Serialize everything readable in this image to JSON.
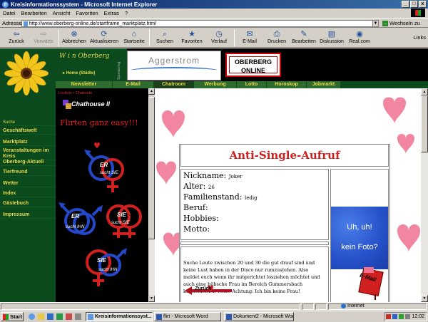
{
  "window": {
    "title": "Kreisinformationssystem - Microsoft Internet Explorer",
    "controls": [
      "_",
      "□",
      "x"
    ]
  },
  "menu": [
    "Datei",
    "Bearbeiten",
    "Ansicht",
    "Favoriten",
    "Extras",
    "?"
  ],
  "address": {
    "label": "Adresse",
    "url": "http://www.oberberg-online.de/startframe_marktplatz.html",
    "go_label": "Wechseln zu"
  },
  "toolbar": {
    "buttons": [
      {
        "label": "Zurück",
        "icon": "back-arrow-icon",
        "glyph": "⇦",
        "disabled": false
      },
      {
        "label": "Vorwärts",
        "icon": "forward-arrow-icon",
        "glyph": "⇨",
        "disabled": true
      },
      {
        "label": "Abbrechen",
        "icon": "stop-icon",
        "glyph": "⊗",
        "disabled": false
      },
      {
        "label": "Aktualisieren",
        "icon": "refresh-icon",
        "glyph": "⟳",
        "disabled": false
      },
      {
        "label": "Startseite",
        "icon": "home-icon",
        "glyph": "⌂",
        "disabled": false
      },
      {
        "label": "Suchen",
        "icon": "search-icon",
        "glyph": "⌕",
        "disabled": false
      },
      {
        "label": "Favoriten",
        "icon": "favorites-icon",
        "glyph": "★",
        "disabled": false
      },
      {
        "label": "Verlauf",
        "icon": "history-icon",
        "glyph": "◷",
        "disabled": false
      },
      {
        "label": "E-Mail",
        "icon": "mail-icon",
        "glyph": "✉",
        "disabled": false
      },
      {
        "label": "Drucken",
        "icon": "print-icon",
        "glyph": "⎙",
        "disabled": false
      },
      {
        "label": "Bearbeiten",
        "icon": "edit-icon",
        "glyph": "✎",
        "disabled": false
      },
      {
        "label": "Diskussion",
        "icon": "discussion-icon",
        "glyph": "▤",
        "disabled": false
      },
      {
        "label": "Real.com",
        "icon": "realcom-icon",
        "glyph": "◉",
        "disabled": false
      }
    ],
    "links_label": "Links"
  },
  "site": {
    "script_title": "W i n Oberberg",
    "home_link": "Home (Städte)",
    "sponsor_label": "Sponsoring",
    "banner1": "Aggerstrom",
    "banner2_line1": "OBERBERG",
    "banner2_line2": "ONLINE",
    "nav_tabs": [
      "Newsletter",
      "E-Mail",
      "Chatroom",
      "Werbung",
      "Lotto",
      "Horoskop",
      "Jobmarkt"
    ],
    "active_tab": "Chatroom",
    "sidebar": [
      {
        "label": "Suche",
        "small": true
      },
      {
        "label": "Geschäftswelt",
        "small": false
      },
      {
        "label": "Marktplatz",
        "small": false
      },
      {
        "label": "Veranstaltungen im Kreis",
        "small": false
      },
      {
        "label": "Oberberg-Aktuell",
        "small": false
      },
      {
        "label": "Tierfreund",
        "small": false
      },
      {
        "label": "Wetter",
        "small": false
      },
      {
        "label": "Index",
        "small": false
      },
      {
        "label": "Gästebuch",
        "small": false
      },
      {
        "label": "Impressum",
        "small": false
      }
    ]
  },
  "chat": {
    "links": "Lexikon • Chatcode",
    "logo": "Chathouse II",
    "tagline": "Flirten ganz easy!!!",
    "symbols": [
      {
        "top": "ER",
        "bottom": "sucht SIE"
      },
      {
        "top": "ER",
        "bottom": "sucht IHN"
      },
      {
        "top": "SIE",
        "bottom": "sucht SIE"
      },
      {
        "top": "SIE",
        "bottom": "sucht IHN"
      }
    ]
  },
  "aufruf": {
    "title": "Anti-Single-Aufruf",
    "fields": [
      {
        "label": "Nickname:",
        "value": "Joker"
      },
      {
        "label": "Alter:",
        "value": "26"
      },
      {
        "label": "Familienstand:",
        "value": "ledig"
      },
      {
        "label": "Beruf:",
        "value": ""
      },
      {
        "label": "Hobbies:",
        "value": ""
      },
      {
        "label": "Motto:",
        "value": ""
      }
    ],
    "description": "Suche Leute zwischen 20 und 30 die gut drauf sind und keine Lust haben in der Disco nur rumzustehen. Also meldet euch wenn ihr mitgerichtet losziehen möchtet und auch eine hübsche Frau im Bereich Gummersbach kennenlernen wollt! Achtung: Ich bin keine Frau!",
    "photo_line1": "Uh, uh!",
    "photo_line2": "kein Foto?"
  },
  "footer_links": {
    "back": "Zurück",
    "email": "E-Mail"
  },
  "status": {
    "zone": "Internet"
  },
  "taskbar": {
    "start": "Start",
    "tasks": [
      {
        "label": "Kreisinformationssyst...",
        "active": true
      },
      {
        "label": "flirt - Microsoft Word",
        "active": false
      },
      {
        "label": "Dokument2 - Microsoft Word",
        "active": false
      }
    ],
    "clock": "12:02"
  },
  "colors": {
    "site_green": "#0b4a1c",
    "site_yellow": "#e8d94a",
    "title_red": "#d02020",
    "heart_pink": "#f07090"
  }
}
